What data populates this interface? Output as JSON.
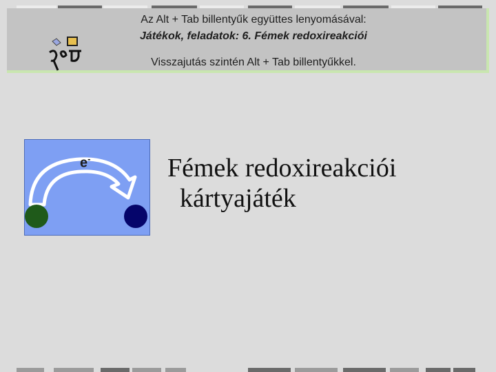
{
  "banner": {
    "line1": "Az Alt + Tab billentyűk együttes lenyomásával:",
    "line2": "Játékok, feladatok: 6. Fémek redoxireakciói",
    "line3": "Visszajutás szintén Alt + Tab billentyűkkel."
  },
  "diagram": {
    "electron_label": "e",
    "electron_charge": "-",
    "colors": {
      "background": "#7e9ff3",
      "arrow": "#ffffff",
      "left_ball": "#1f5a1a",
      "right_ball": "#05056b"
    }
  },
  "title": {
    "line1": "Fémek redoxireakciói",
    "line2": "kártyajáték"
  },
  "icons": {
    "logo": "handwritten-logo-icon",
    "arrow": "curved-arrow-icon"
  }
}
